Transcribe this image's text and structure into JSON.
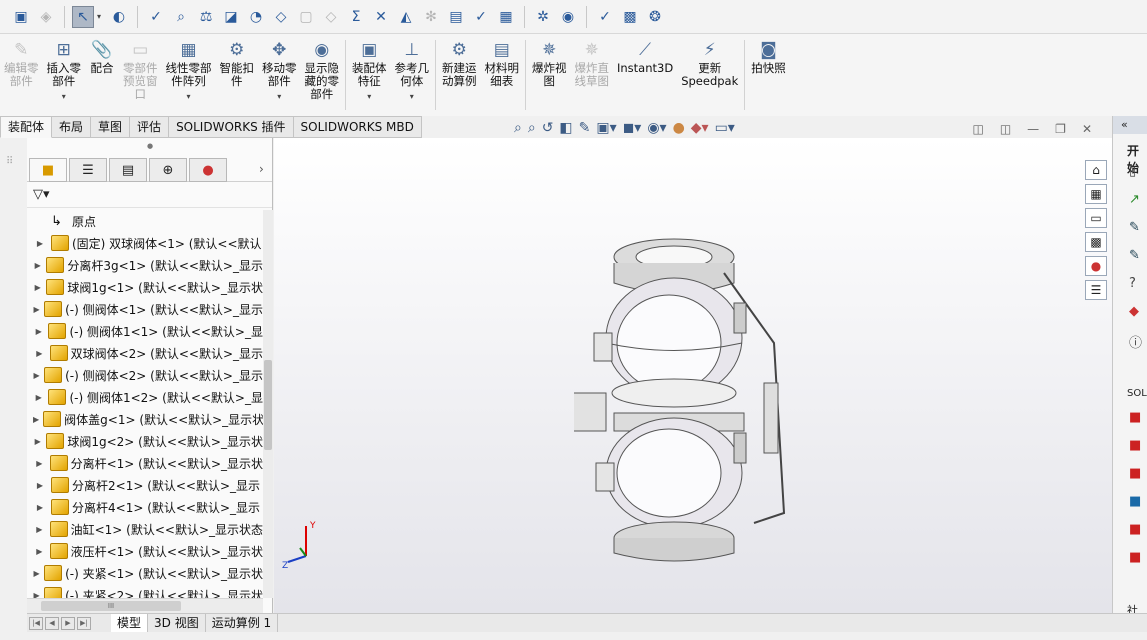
{
  "quick_access": {
    "icons": [
      "new-part-icon",
      "rebuild-icon",
      "select-arrow-icon",
      "appearance-icon",
      "spelling-icon",
      "measure-icon",
      "mass-properties-icon",
      "section-icon",
      "analysis-icon",
      "thickness-icon",
      "check-icon",
      "symmetry-icon",
      "sum-icon",
      "interference-icon",
      "curvature-icon",
      "zebra-icon",
      "hole-icon",
      "deviation-icon",
      "excel-icon",
      "toolbox-icon",
      "sustainability-icon",
      "checker-icon",
      "powerpoint-icon",
      "settings-icon"
    ]
  },
  "command_manager": {
    "buttons": [
      {
        "label": "编辑零\n部件",
        "dim": true
      },
      {
        "label": "插入零\n部件",
        "dd": "▾"
      },
      {
        "label": "配合"
      },
      {
        "label": "零部件\n预览窗\n口",
        "dim": true
      },
      {
        "label": "线性零部\n件阵列",
        "dd": "▾"
      },
      {
        "label": "智能扣\n件"
      },
      {
        "label": "移动零\n部件",
        "dd": "▾"
      },
      {
        "label": "显示隐\n藏的零\n部件"
      },
      {
        "label": "装配体\n特征",
        "dd": "▾"
      },
      {
        "label": "参考几\n何体",
        "dd": "▾"
      },
      {
        "label": "新建运\n动算例"
      },
      {
        "label": "材料明\n细表"
      },
      {
        "label": "爆炸视\n图"
      },
      {
        "label": "爆炸直\n线草图",
        "dim": true
      },
      {
        "label": "Instant3D"
      },
      {
        "label": "更新\nSpeedpak"
      },
      {
        "label": "拍快照"
      }
    ]
  },
  "tabs": [
    "装配体",
    "布局",
    "草图",
    "评估",
    "SOLIDWORKS 插件",
    "SOLIDWORKS MBD"
  ],
  "tree": {
    "origin": "原点",
    "items": [
      "(固定) 双球阀体<1> (默认<<默认",
      "分离杆3g<1> (默认<<默认>_显示",
      "球阀1g<1> (默认<<默认>_显示状",
      "(-) 侧阀体<1> (默认<<默认>_显示",
      "(-) 侧阀体1<1> (默认<<默认>_显",
      "双球阀体<2> (默认<<默认>_显示",
      "(-) 侧阀体<2> (默认<<默认>_显示",
      "(-) 侧阀体1<2> (默认<<默认>_显",
      "阀体盖g<1> (默认<<默认>_显示状",
      "球阀1g<2> (默认<<默认>_显示状",
      "分离杆<1> (默认<<默认>_显示状",
      "分离杆2<1> (默认<<默认>_显示",
      "分离杆4<1> (默认<<默认>_显示",
      "油缸<1> (默认<<默认>_显示状态",
      "液压杆<1> (默认<<默认>_显示状",
      "(-) 夹紧<1> (默认<<默认>_显示状",
      "(-) 夹紧<2> (默认<<默认>_显示状"
    ]
  },
  "task_pane": {
    "header": "开始",
    "section": "SOLI",
    "bottom": "社区"
  },
  "bottom_tabs": [
    "模型",
    "3D 视图",
    "运动算例 1"
  ],
  "colors": {
    "accent": "#4d6e98",
    "folder": "#e2a400"
  }
}
